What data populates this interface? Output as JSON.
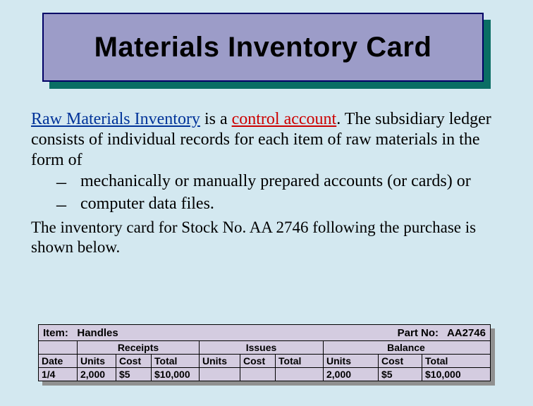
{
  "title": "Materials Inventory Card",
  "paragraph1": {
    "term1": "Raw Materials Inventory",
    "mid1": " is a ",
    "term2": "control account",
    "tail": ".  The subsidiary ledger consists of individual records for each item of raw materials in the form of"
  },
  "bullets": [
    "mechanically or manually prepared accounts (or cards) or",
    "computer data files."
  ],
  "paragraph2": "The inventory card for Stock No. AA 2746 following the purchase is shown below.",
  "card": {
    "item_label": "Item:",
    "item_value": "Handles",
    "part_label": "Part No:",
    "part_value": "AA2746",
    "sections": {
      "receipts": "Receipts",
      "issues": "Issues",
      "balance": "Balance"
    },
    "headers": {
      "date": "Date",
      "units": "Units",
      "cost": "Cost",
      "total": "Total"
    },
    "row": {
      "date": "1/4",
      "receipts": {
        "units": "2,000",
        "cost": "$5",
        "total": "$10,000"
      },
      "issues": {
        "units": "",
        "cost": "",
        "total": ""
      },
      "balance": {
        "units": "2,000",
        "cost": "$5",
        "total": "$10,000"
      }
    }
  }
}
